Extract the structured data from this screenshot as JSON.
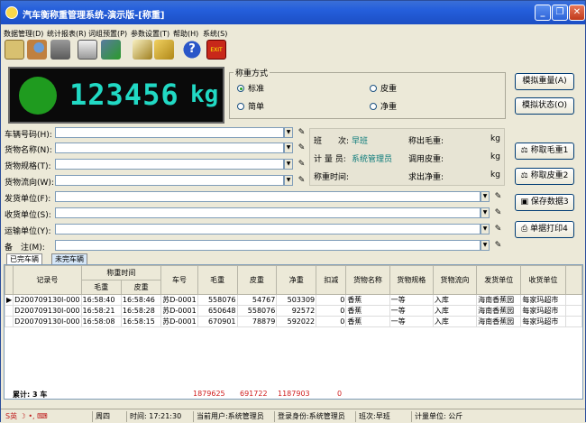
{
  "app": {
    "title": "汽车衡称重管理系统-演示版-[称重]"
  },
  "window_controls": {
    "min": "_",
    "restore": "❐",
    "close": "✕"
  },
  "menu": [
    "数据管理(D)",
    "统计报表(R)",
    "词组预置(P)",
    "参数设置(T)",
    "帮助(H)",
    "系统(S)"
  ],
  "toolbar": [
    {
      "icon": "data-manage-icon"
    },
    {
      "icon": "search-person-icon"
    },
    {
      "icon": "trash-icon"
    },
    {
      "icon": "print-icon"
    },
    {
      "icon": "export-icon"
    },
    {
      "icon": "settings-icon"
    },
    {
      "icon": "keys-icon"
    },
    {
      "icon": "help-icon"
    },
    {
      "icon": "exit-icon"
    }
  ],
  "display": {
    "weight": "123456",
    "unit": "kg",
    "led_color": "#1f9b1f"
  },
  "mode": {
    "legend": "称重方式",
    "options": [
      "标准",
      "皮重",
      "简单",
      "净重"
    ],
    "selected": "标准"
  },
  "buttons": {
    "sim_weight": "模拟重量(A)",
    "sim_state": "模拟状态(O)",
    "gross": "称取毛重1",
    "tare": "称取皮重2",
    "save": "保存数据3",
    "print": "单据打印4"
  },
  "fields": [
    {
      "label": "车辆号码(H):",
      "value": ""
    },
    {
      "label": "货物名称(N):",
      "value": ""
    },
    {
      "label": "货物规格(T):",
      "value": ""
    },
    {
      "label": "货物流向(W):",
      "value": ""
    },
    {
      "label": "发货单位(F):",
      "value": ""
    },
    {
      "label": "收货单位(S):",
      "value": ""
    },
    {
      "label": "运输单位(Y):",
      "value": ""
    },
    {
      "label": "备　注(M):",
      "value": ""
    }
  ],
  "info": {
    "shift_label": "班　　次:",
    "shift_value": "早班",
    "operator_label": "计 量 员:",
    "operator_value": "系统管理员",
    "time_label": "称重时间:",
    "gross_label": "称出毛重:",
    "tare_label": "调用皮重:",
    "net_label": "求出净重:",
    "unit": "kg"
  },
  "tabs": [
    "已完车辆",
    "未完车辆"
  ],
  "table": {
    "headers": [
      "记录号",
      "称重时间",
      "毛重",
      "皮重",
      "车号",
      "毛重",
      "皮重",
      "净重",
      "扣减",
      "货物名称",
      "货物规格",
      "货物流向",
      "发货单位",
      "收货单位"
    ],
    "rows": [
      [
        "D200709130l-000",
        "16:58:40",
        "16:58:46",
        "苏D-0001",
        "558076",
        "54767",
        "503309",
        "0",
        "香蕉",
        "一等",
        "入库",
        "海南香蕉园",
        "每家玛超市"
      ],
      [
        "D200709130l-000",
        "16:58:21",
        "16:58:28",
        "苏D-0001",
        "650648",
        "558076",
        "92572",
        "0",
        "香蕉",
        "一等",
        "入库",
        "海南香蕉园",
        "每家玛超市"
      ],
      [
        "D200709130l-000",
        "16:58:08",
        "16:58:15",
        "苏D-0001",
        "670901",
        "78879",
        "592022",
        "0",
        "香蕉",
        "一等",
        "入库",
        "海南香蕉园",
        "每家玛超市"
      ]
    ],
    "sum": {
      "label": "累计: 3 车",
      "gross": "1879625",
      "tare": "691722",
      "net": "1187903",
      "deduct": "0"
    }
  },
  "status": {
    "weekday": "周四",
    "time": "时间: 17:21:30",
    "user": "当前用户:系统管理员",
    "role": "登录身份:系统管理员",
    "shift": "班次:早班",
    "unit": "计量单位: 公斤",
    "ime": "S英"
  }
}
